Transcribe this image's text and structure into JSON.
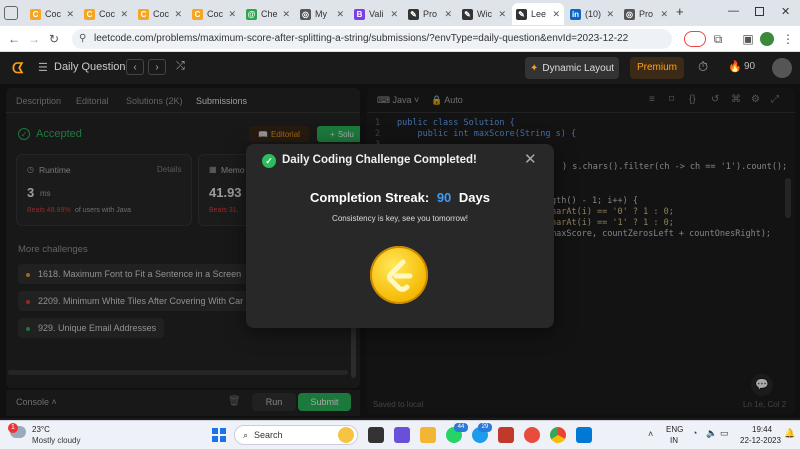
{
  "browser": {
    "tabs": [
      {
        "label": "Coc",
        "favicon_color": "#f5a623"
      },
      {
        "label": "Coc",
        "favicon_color": "#f5a623"
      },
      {
        "label": "Coc",
        "favicon_color": "#f5a623"
      },
      {
        "label": "Coc",
        "favicon_color": "#f5a623"
      },
      {
        "label": "Che",
        "favicon_color": "#2ea44f"
      },
      {
        "label": "My",
        "favicon_color": "#555555"
      },
      {
        "label": "Vali",
        "favicon_color": "#7b3fe4"
      },
      {
        "label": "Pro",
        "favicon_color": "#333333"
      },
      {
        "label": "Wic",
        "favicon_color": "#333333"
      },
      {
        "label": "Lee",
        "favicon_color": "#333333"
      },
      {
        "label": "(10)",
        "favicon_color": "#0a66c2"
      },
      {
        "label": "Pro",
        "favicon_color": "#555555"
      }
    ],
    "new_tab": "+",
    "url": "leetcode.com/problems/maximum-score-after-splitting-a-string/submissions/?envType=daily-question&envId=2023-12-22"
  },
  "header": {
    "title": "Daily Question",
    "dynamic_layout": "Dynamic Layout",
    "premium": "Premium",
    "streak_count": "90"
  },
  "left": {
    "tabs": [
      "Description",
      "Editorial",
      "Solutions (2K)",
      "Submissions"
    ],
    "status": "Accepted",
    "editorial_btn": "Editorial",
    "solution_btn": "Solu",
    "runtime_label": "Runtime",
    "details": "Details",
    "runtime_value": "3",
    "runtime_unit": "ms",
    "beats_pct": "Beats 48.89%",
    "beats_text": "of users with Java",
    "memory_label": "Memo",
    "memory_value": "41.93",
    "memory_beats": "Beats 31.",
    "more_title": "More challenges",
    "challenges": [
      {
        "label": "1618. Maximum Font to Fit a Sentence in a Screen",
        "color": "#f0a020"
      },
      {
        "label": "2209. Minimum White Tiles After Covering With Car",
        "color": "#e04040"
      },
      {
        "label": "929. Unique Email Addresses",
        "color": "#2db55d"
      }
    ]
  },
  "bottom": {
    "console": "Console",
    "run": "Run",
    "submit": "Submit"
  },
  "editor": {
    "language": "Java",
    "auto": "Auto",
    "saved": "Saved to local",
    "cursor": "Ln 1e, Col 2",
    "lines": [
      {
        "n": "1",
        "t": "public class Solution {"
      },
      {
        "n": "2",
        "t": "    public int maxScore(String s) {"
      },
      {
        "n": "3",
        "t": ""
      },
      {
        "n": "4",
        "t": ") s.chars().filter(ch -> ch == '1').count();"
      },
      {
        "n": "5",
        "t": ""
      },
      {
        "n": "6",
        "t": ""
      },
      {
        "n": "7",
        "t": "gth() - 1; i++) {"
      },
      {
        "n": "8",
        "t": "harAt(i) == '0' ? 1 : 0;"
      },
      {
        "n": "9",
        "t": "harAt(i) == '1' ? 1 : 0;"
      },
      {
        "n": "10",
        "t": "maxScore, countZerosLeft + countOnesRight);"
      }
    ]
  },
  "modal": {
    "title": "Daily Coding Challenge Completed!",
    "streak_label": "Completion Streak:",
    "streak_value": "90",
    "streak_unit": "Days",
    "message": "Consistency is key, see you tomorrow!"
  },
  "taskbar": {
    "weather_temp": "23°C",
    "weather_desc": "Mostly cloudy",
    "search": "Search",
    "lang1": "ENG",
    "lang2": "IN",
    "time": "19:44",
    "date": "22-12-2023",
    "badge_weather": "1",
    "badge_a": "44",
    "badge_b": "29"
  },
  "colors": {
    "accent_green": "#2cbb5d",
    "accent_blue": "#3e9cf5",
    "lc_orange": "#ffa116",
    "premium_bg": "#3b2a17"
  }
}
